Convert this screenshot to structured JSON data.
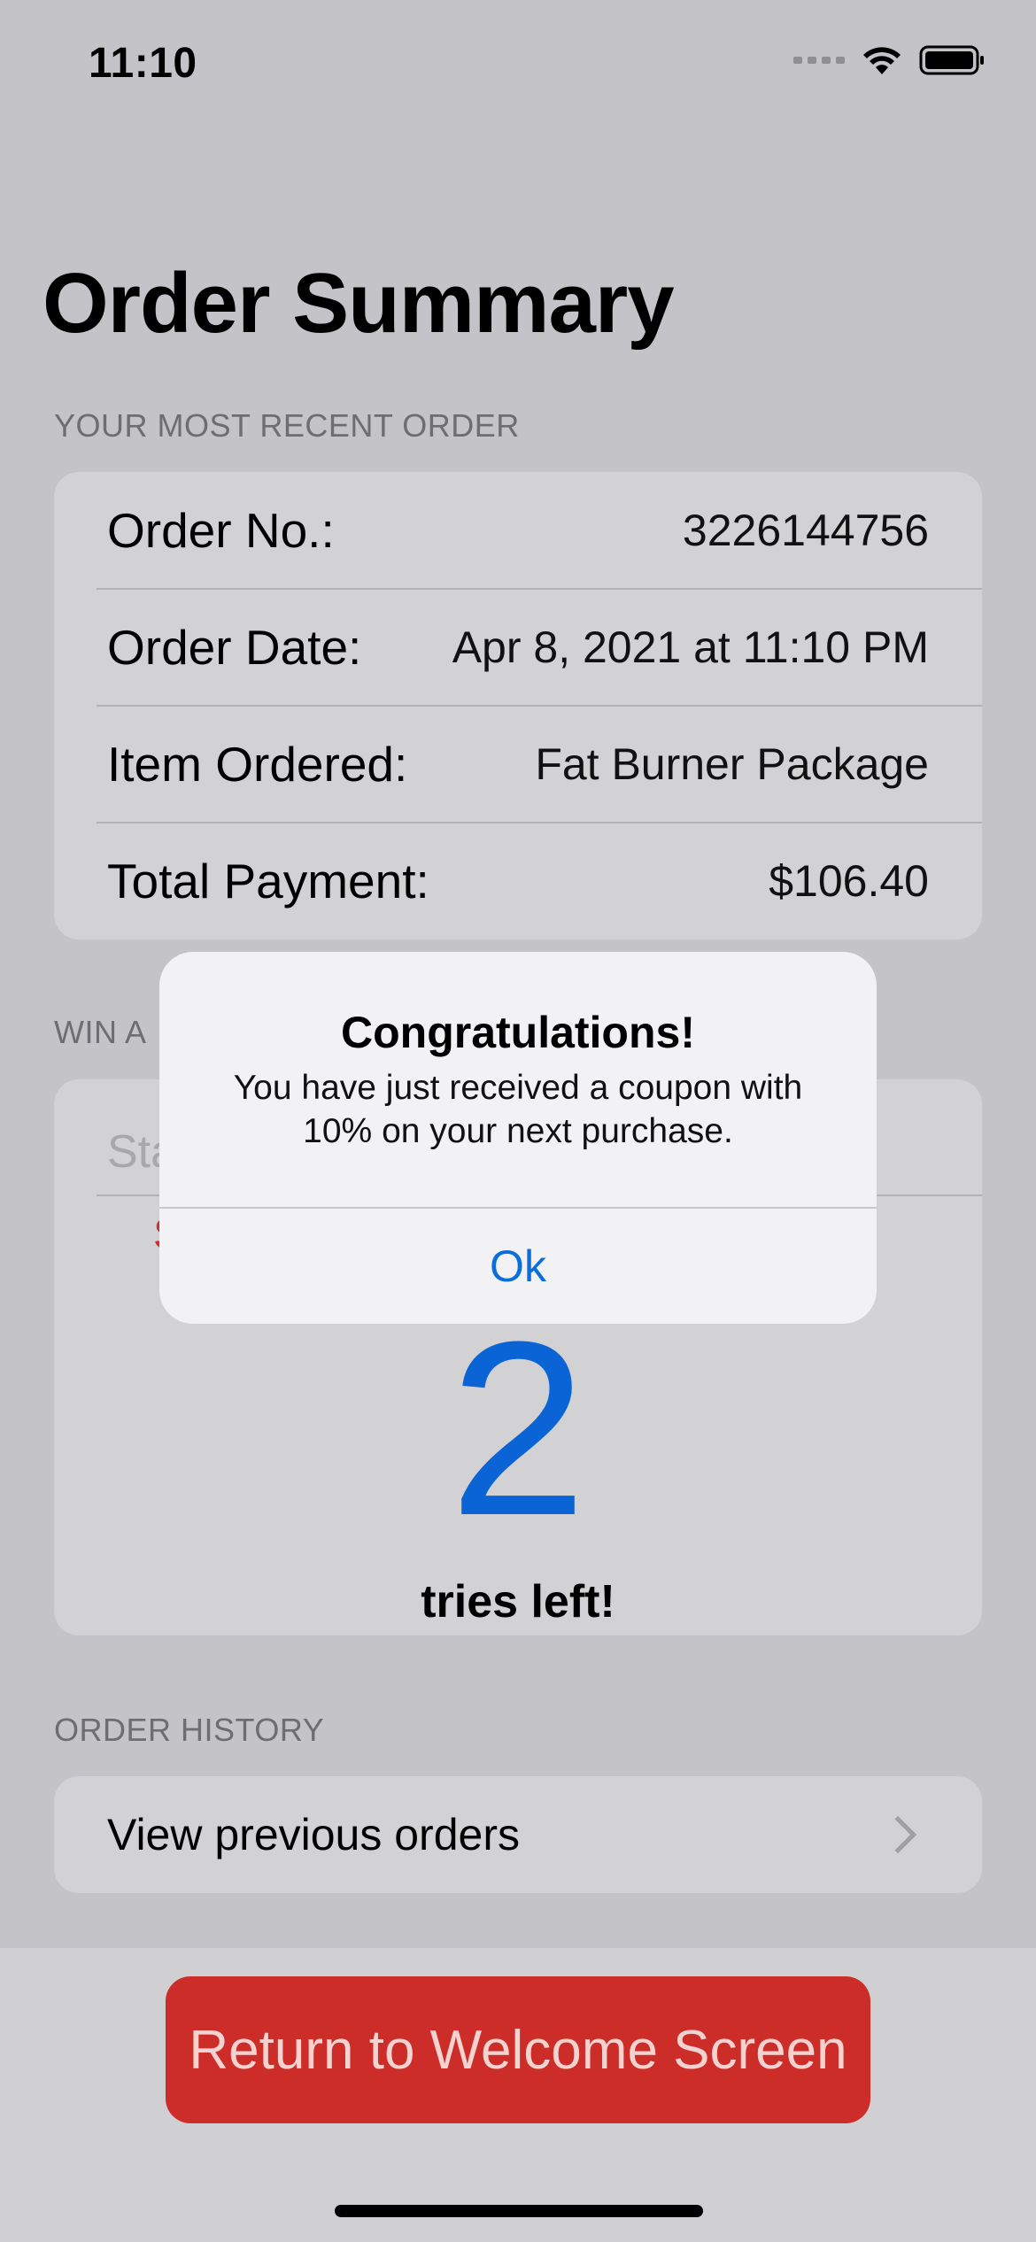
{
  "status_bar": {
    "time": "11:10"
  },
  "page_title": "Order Summary",
  "recent_order": {
    "header": "YOUR MOST RECENT ORDER",
    "rows": [
      {
        "label": "Order No.:",
        "value": "3226144756"
      },
      {
        "label": "Order Date:",
        "value": "Apr 8, 2021 at 11:10 PM"
      },
      {
        "label": "Item Ordered:",
        "value": "Fat Burner Package"
      },
      {
        "label": "Total Payment:",
        "value": "$106.40"
      }
    ]
  },
  "win_section": {
    "header_visible": "WIN A",
    "input_placeholder_visible": "Sta",
    "red_text_visible": "S",
    "tries_number": "2",
    "tries_label": "tries left!"
  },
  "order_history": {
    "header": "ORDER HISTORY",
    "row_label": "View previous orders"
  },
  "return_button_label": "Return to Welcome Screen",
  "alert": {
    "title": "Congratulations!",
    "message": "You have just received a coupon with 10% on your next purchase.",
    "button_label": "Ok"
  },
  "colors": {
    "accent_blue": "#0a64d6",
    "button_red": "#cc2d28"
  }
}
